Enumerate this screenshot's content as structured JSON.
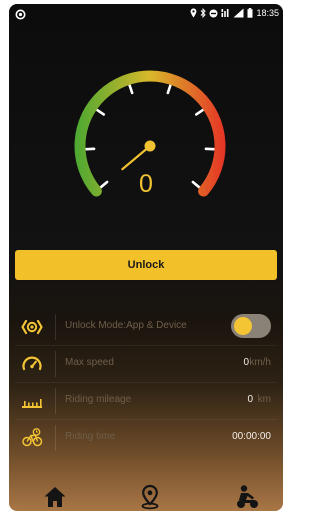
{
  "status_bar": {
    "time": "18:35",
    "icons": [
      "app-notification-icon",
      "location-icon",
      "bluetooth-icon",
      "do-not-disturb-icon",
      "signal-4g-icon",
      "battery-icon"
    ]
  },
  "gauge": {
    "speed_value": "0",
    "needle_level": 0,
    "colors": {
      "green": "#4aa832",
      "yellow": "#d8b82a",
      "red": "#e63226",
      "needle": "#f0c232"
    }
  },
  "unlock_button": {
    "label": "Unlock"
  },
  "info_rows": [
    {
      "icon": "unlock-mode-icon",
      "label": "Unlock Mode:App & Device",
      "toggle_on": true
    },
    {
      "icon": "speedometer-icon",
      "label": "Max speed",
      "value": "0",
      "unit": "km/h"
    },
    {
      "icon": "road-mileage-icon",
      "label": "Riding mileage",
      "value": "0",
      "unit": "km"
    },
    {
      "icon": "bicycle-time-icon",
      "label": "Riding time",
      "value": "00:00:00"
    }
  ],
  "bottom_nav": {
    "items": [
      "home-icon",
      "location-pin-icon",
      "rider-icon"
    ]
  },
  "colors": {
    "accent": "#f2c029",
    "background": "#121212",
    "muted_text": "#6f5f4a"
  }
}
